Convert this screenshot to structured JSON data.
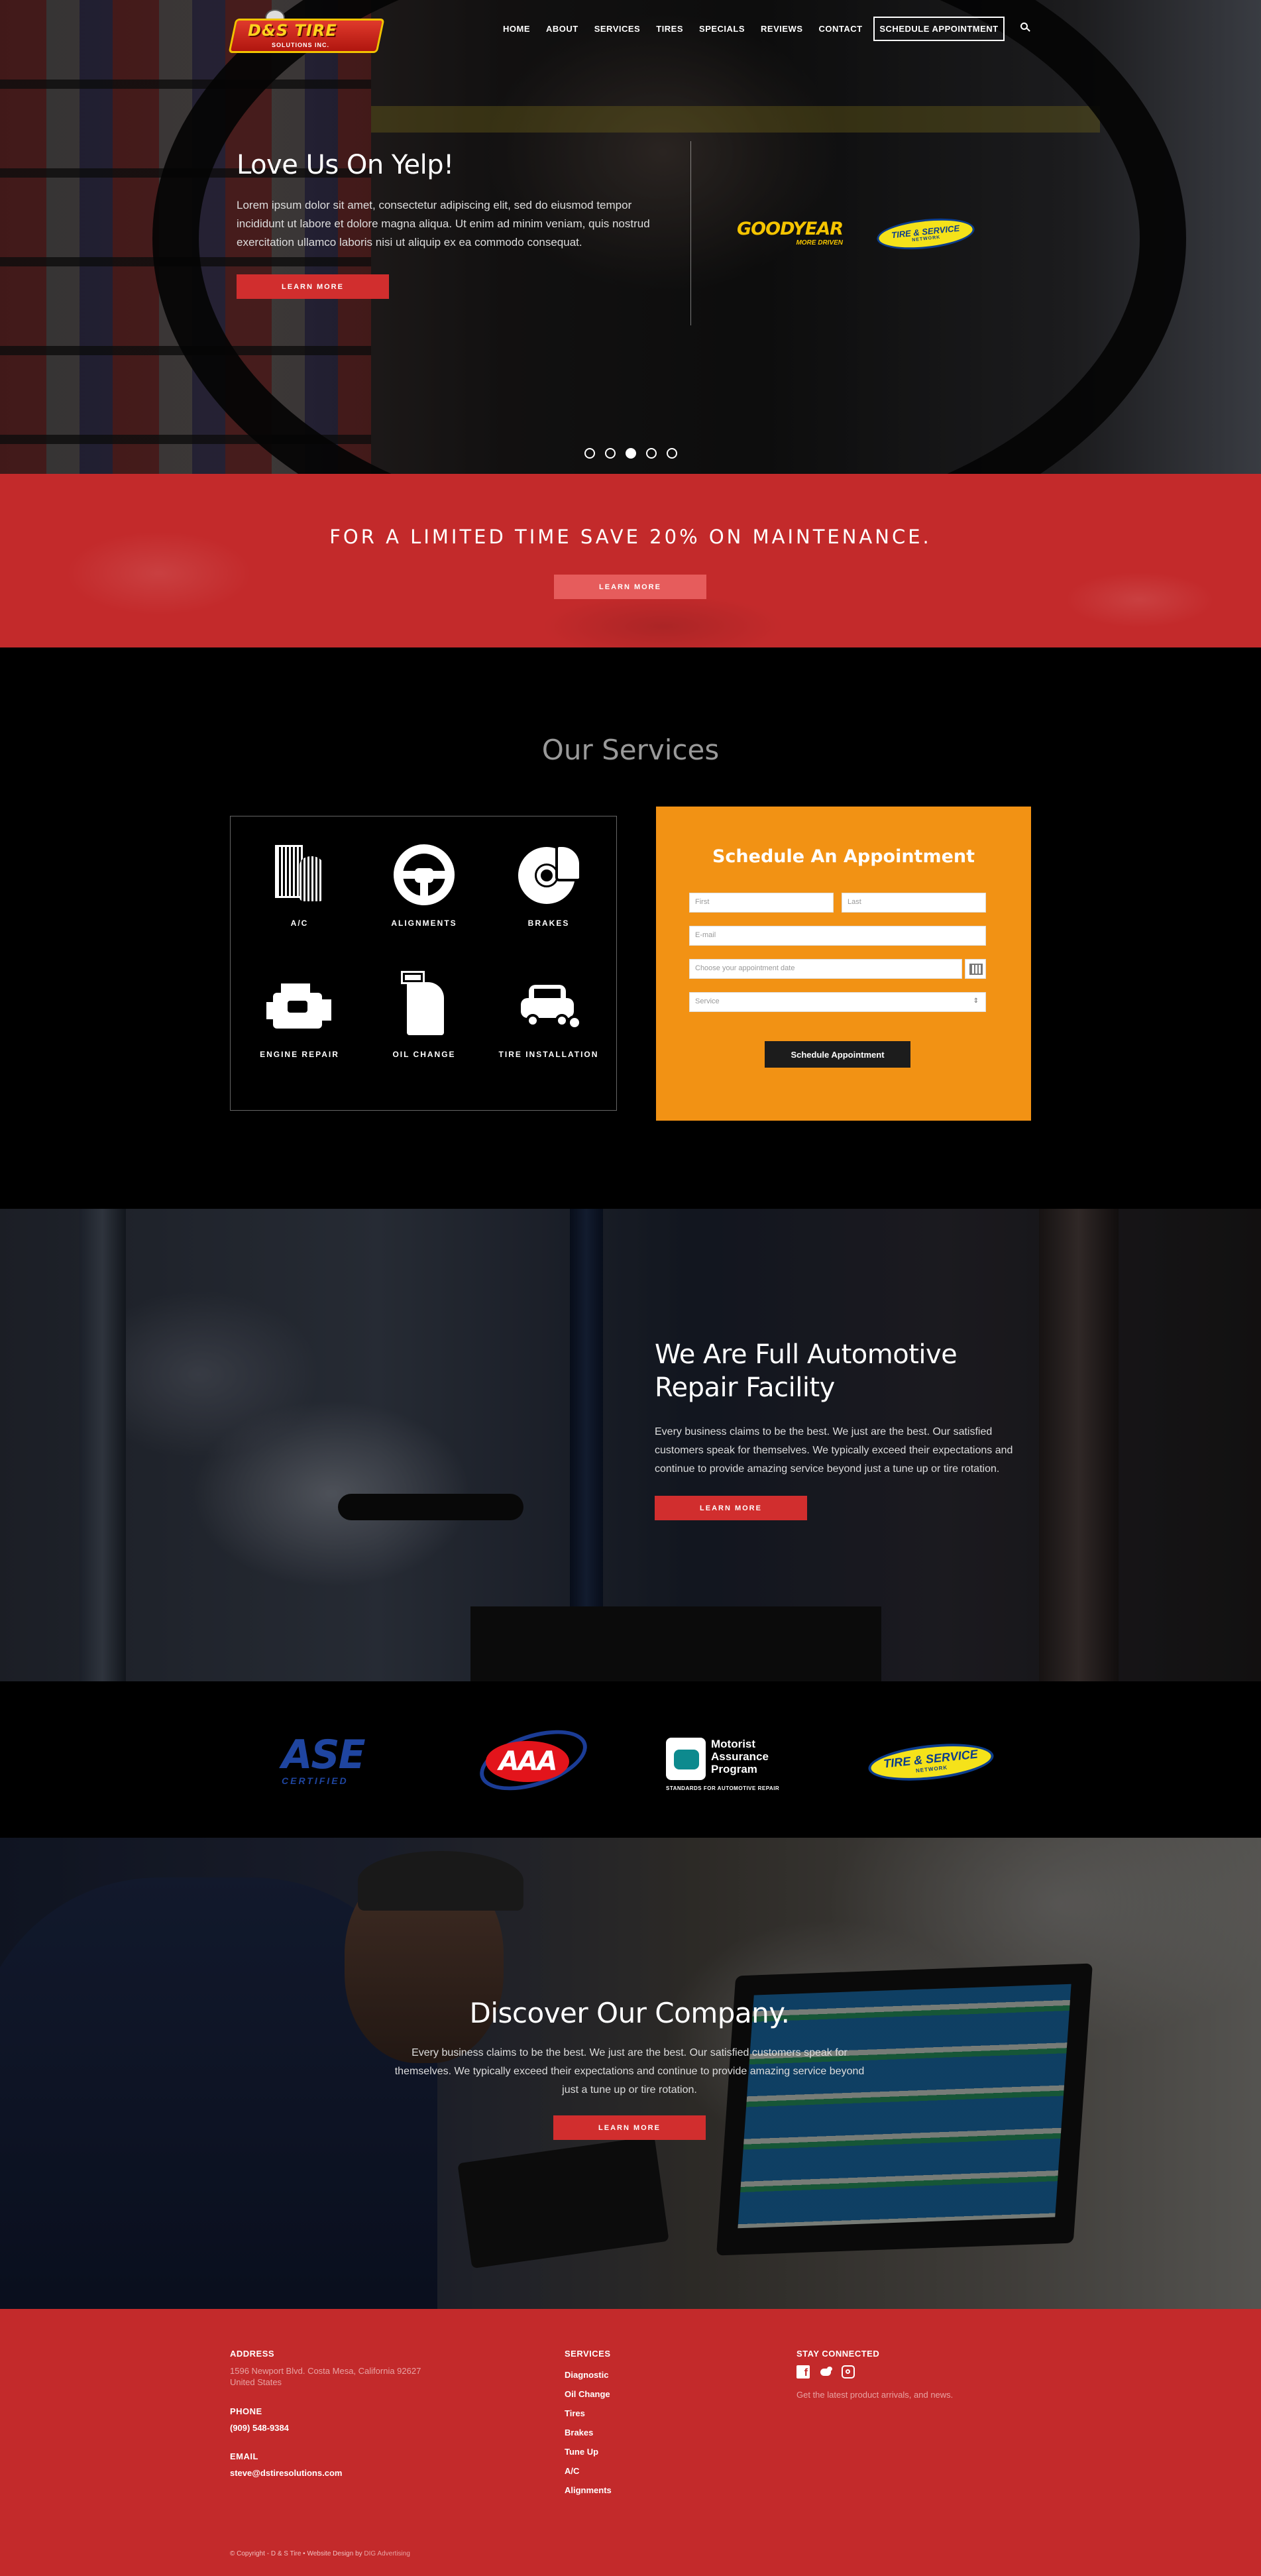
{
  "brand": {
    "logo_text": "D&S TIRE",
    "logo_subtext": "SOLUTIONS INC."
  },
  "nav": {
    "items": [
      {
        "label": "HOME"
      },
      {
        "label": "ABOUT"
      },
      {
        "label": "SERVICES"
      },
      {
        "label": "TIRES"
      },
      {
        "label": "SPECIALS"
      },
      {
        "label": "REVIEWS"
      },
      {
        "label": "CONTACT"
      }
    ],
    "cta_label": "SCHEDULE APPOINTMENT",
    "search_icon": "search-icon"
  },
  "hero": {
    "title": "Love Us On Yelp!",
    "text": "Lorem ipsum dolor sit amet, consectetur adipiscing elit, sed do eiusmod tempor incididunt ut labore et dolore magna aliqua. Ut enim ad minim veniam, quis nostrud exercitation ullamco laboris nisi ut aliquip ex ea commodo consequat.",
    "button_label": "LEARN MORE",
    "partners": {
      "goodyear": "GOODYEAR",
      "goodyear_tagline": "MORE DRIVEN",
      "tsn": "TIRE & SERVICE",
      "tsn_sub": "NETWORK"
    },
    "slides_total": 5,
    "active_slide": 3
  },
  "promo": {
    "title": "FOR A LIMITED TIME SAVE 20% ON MAINTENANCE.",
    "button_label": "LEARN MORE"
  },
  "services": {
    "title": "Our Services",
    "items": [
      {
        "label": "A/C",
        "icon": "ac-filter-icon"
      },
      {
        "label": "ALIGNMENTS",
        "icon": "steering-wheel-icon"
      },
      {
        "label": "BRAKES",
        "icon": "brake-disc-icon"
      },
      {
        "label": "ENGINE REPAIR",
        "icon": "engine-icon"
      },
      {
        "label": "OIL CHANGE",
        "icon": "oil-can-icon"
      },
      {
        "label": "TIRE INSTALLATION",
        "icon": "car-tire-icon"
      }
    ]
  },
  "appointment": {
    "title": "Schedule An Appointment",
    "first_placeholder": "First",
    "last_placeholder": "Last",
    "email_placeholder": "E-mail",
    "date_placeholder": "Choose your appointment date",
    "service_selected": "Service",
    "submit_label": "Schedule Appointment"
  },
  "facility": {
    "title": "We Are Full Automotive Repair Facility",
    "text": "Every business claims to be the best. We just are the best. Our satisfied customers speak for themselves. We typically exceed their expectations and continue to provide amazing service beyond just a tune up or tire rotation.",
    "button_label": "LEARN MORE"
  },
  "certs": {
    "ase": "ASE",
    "ase_sub": "CERTIFIED",
    "aaa": "AAA",
    "map_line1": "Motorist",
    "map_line2": "Assurance",
    "map_line3": "Program",
    "map_sub": "STANDARDS FOR AUTOMOTIVE REPAIR",
    "tsn": "TIRE & SERVICE",
    "tsn_sub": "NETWORK"
  },
  "discover": {
    "title": "Discover Our Company.",
    "text": "Every business claims to be the best. We just are the best. Our satisfied customers speak for themselves. We typically exceed their expectations and continue to provide amazing service beyond just a tune up or tire rotation.",
    "button_label": "LEARN MORE"
  },
  "footer": {
    "address_heading": "ADDRESS",
    "address_line1": "1596 Newport Blvd. Costa Mesa, California 92627",
    "address_line2": "United States",
    "phone_heading": "PHONE",
    "phone": "(909) 548-9384",
    "email_heading": "EMAIL",
    "email": "steve@dstiresolutions.com",
    "services_heading": "SERVICES",
    "services_links": [
      "Diagnostic",
      "Oil Change",
      "Tires",
      "Brakes",
      "Tune Up",
      "A/C",
      "Alignments"
    ],
    "connect_heading": "STAY CONNECTED",
    "connect_text": "Get the latest product arrivals, and news.",
    "copyright": "© Copyright - D & S Tire • Website Design by ",
    "copyright_link": "DIG Advertising"
  }
}
